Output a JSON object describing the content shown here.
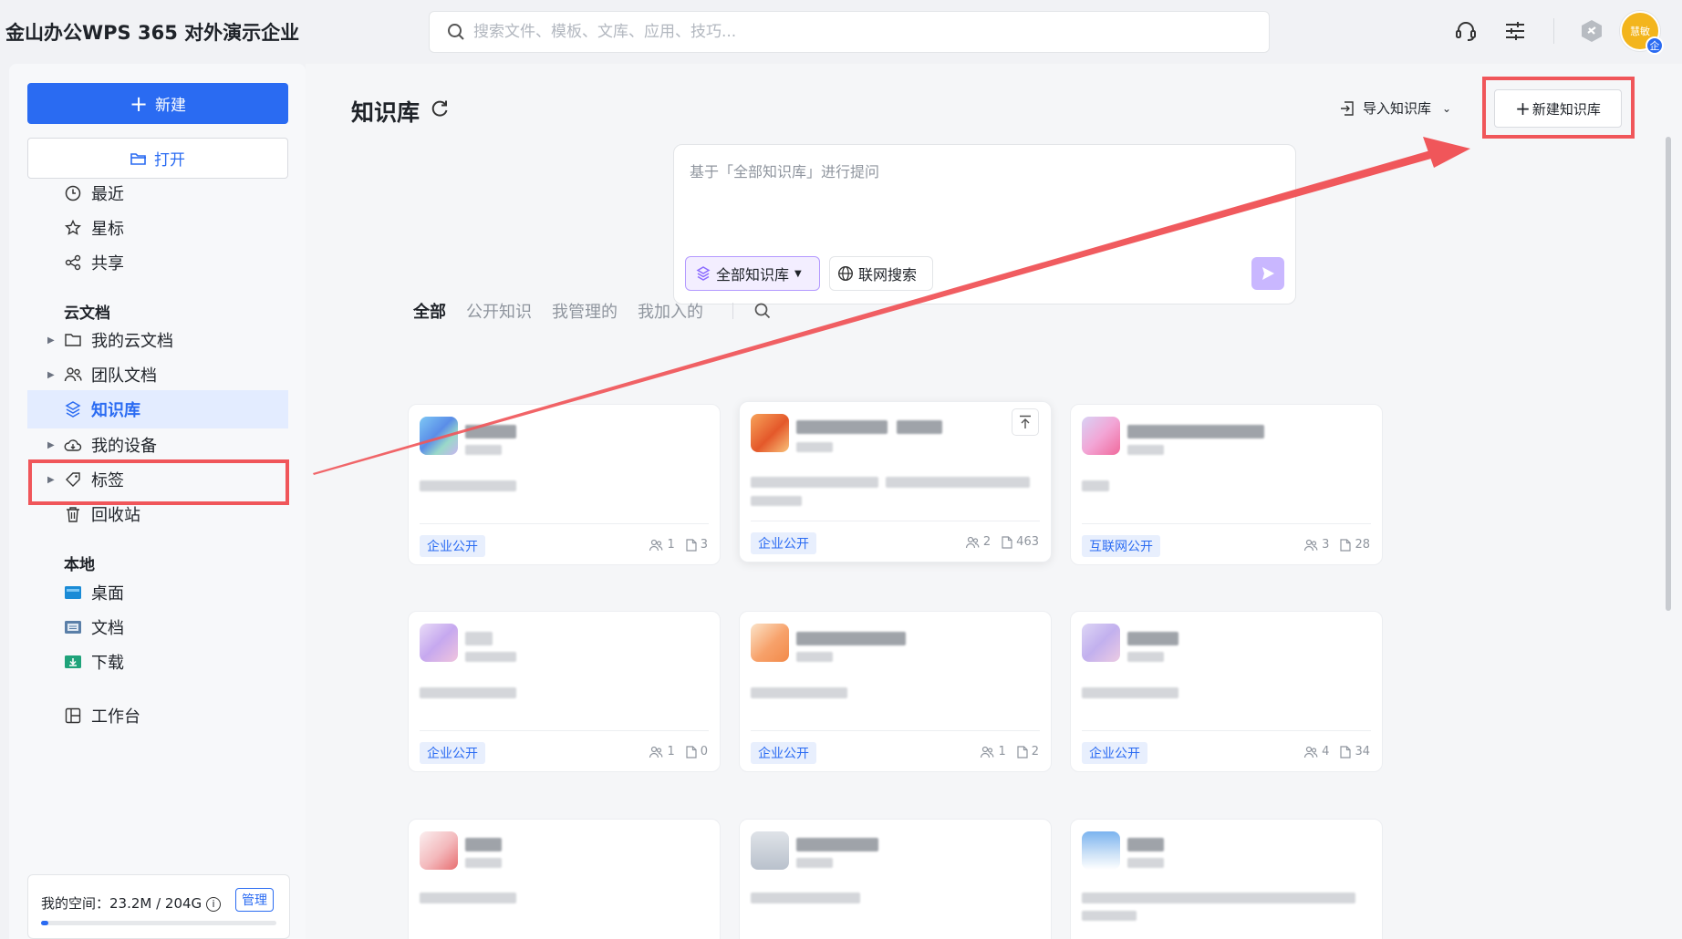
{
  "app": {
    "title": "金山办公WPS 365 对外演示企业"
  },
  "search": {
    "placeholder": "搜索文件、模板、文库、应用、技巧..."
  },
  "user": {
    "avatar_text": "慧敏",
    "badge": "企"
  },
  "sidebar": {
    "new_label": "新建",
    "open_label": "打开",
    "quick": [
      {
        "label": "最近",
        "icon": "clock-icon"
      },
      {
        "label": "星标",
        "icon": "star-icon"
      },
      {
        "label": "共享",
        "icon": "share-icon"
      }
    ],
    "cloud_section": "云文档",
    "cloud": [
      {
        "label": "我的云文档",
        "icon": "folder-icon"
      },
      {
        "label": "团队文档",
        "icon": "team-icon"
      },
      {
        "label": "知识库",
        "icon": "knowledge-icon"
      },
      {
        "label": "我的设备",
        "icon": "cloud-device-icon"
      },
      {
        "label": "标签",
        "icon": "tag-icon"
      },
      {
        "label": "回收站",
        "icon": "trash-icon"
      }
    ],
    "local_section": "本地",
    "local": [
      {
        "label": "桌面",
        "icon": "desktop-folder-icon"
      },
      {
        "label": "文档",
        "icon": "documents-folder-icon"
      },
      {
        "label": "下载",
        "icon": "download-folder-icon"
      }
    ],
    "workbench": "工作台",
    "storage": {
      "text": "我的空间：23.2M / 204G",
      "manage": "管理",
      "used_fraction": 0.03
    }
  },
  "main": {
    "title": "知识库",
    "import_label": "导入知识库",
    "new_kb_label": "新建知识库",
    "ask_placeholder": "基于「全部知识库」进行提问",
    "scope_label": "全部知识库",
    "web_search_label": "联网搜索",
    "tabs": [
      "全部",
      "公开知识",
      "我管理的",
      "我加入的"
    ],
    "cards": [
      {
        "badge": "企业公开",
        "members": "1",
        "docs": "3"
      },
      {
        "badge": "企业公开",
        "members": "2",
        "docs": "463"
      },
      {
        "badge": "互联网公开",
        "members": "3",
        "docs": "28"
      },
      {
        "badge": "企业公开",
        "members": "1",
        "docs": "0"
      },
      {
        "badge": "企业公开",
        "members": "1",
        "docs": "2"
      },
      {
        "badge": "企业公开",
        "members": "4",
        "docs": "34"
      }
    ]
  },
  "colors": {
    "accent": "#2a6bf2",
    "annotation": "#f0565a",
    "ai_purple": "#8c6cff"
  }
}
